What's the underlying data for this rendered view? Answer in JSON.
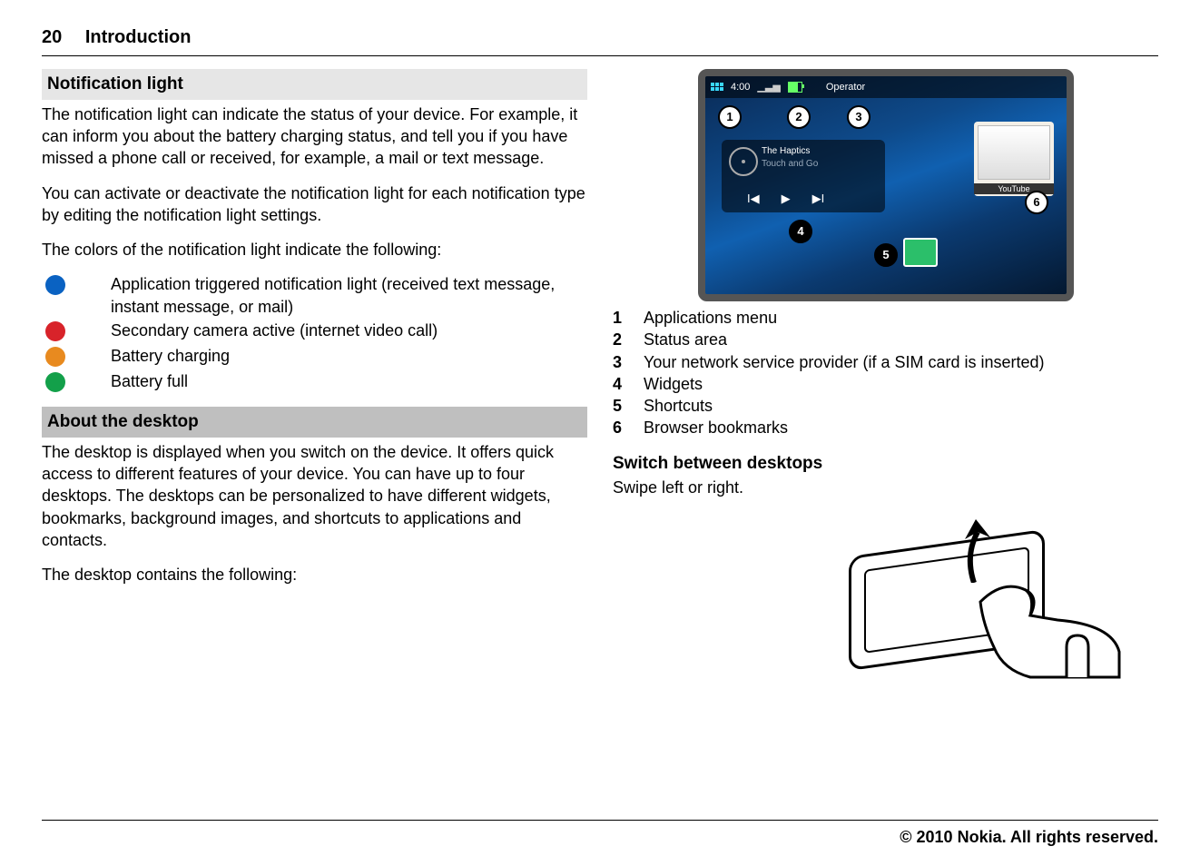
{
  "header": {
    "page_number": "20",
    "chapter": "Introduction"
  },
  "footer": "© 2010 Nokia. All rights reserved.",
  "left": {
    "section1_title": "Notification light",
    "p1": "The notification light can indicate the status of your device. For example, it can inform you about the battery charging status, and tell you if you have missed a phone call or received, for example, a mail or text message.",
    "p2": "You can activate or deactivate the notification light for each notification type by editing the notification light settings.",
    "p3": "The colors of the notification light indicate the following:",
    "leds": [
      {
        "color": "blue",
        "text": "Application triggered notification light (received text message, instant message, or mail)"
      },
      {
        "color": "red",
        "text": "Secondary camera active (internet video call)"
      },
      {
        "color": "orange",
        "text": "Battery charging"
      },
      {
        "color": "green",
        "text": "Battery full"
      }
    ],
    "section2_title": "About the desktop",
    "p4": "The desktop is displayed when you switch on the device. It offers quick access to different features of your device. You can have up to four desktops. The desktops can be personalized to have different widgets, bookmarks, background images, and shortcuts to applications and contacts.",
    "p5": "The desktop contains the following:"
  },
  "right": {
    "screenshot": {
      "clock": "4:00",
      "operator": "Operator",
      "music_title": "The Haptics",
      "music_sub": "Touch and Go",
      "youtube_label": "YouTube",
      "callouts": {
        "c1": "1",
        "c2": "2",
        "c3": "3",
        "c4": "4",
        "c5": "5",
        "c6": "6"
      }
    },
    "legend": [
      {
        "n": "1",
        "t": "Applications menu"
      },
      {
        "n": "2",
        "t": "Status area"
      },
      {
        "n": "3",
        "t": "Your network service provider (if a SIM card is inserted)"
      },
      {
        "n": "4",
        "t": "Widgets"
      },
      {
        "n": "5",
        "t": "Shortcuts"
      },
      {
        "n": "6",
        "t": "Browser bookmarks"
      }
    ],
    "sub_heading": "Switch between desktops",
    "sub_text": "Swipe left or right."
  }
}
